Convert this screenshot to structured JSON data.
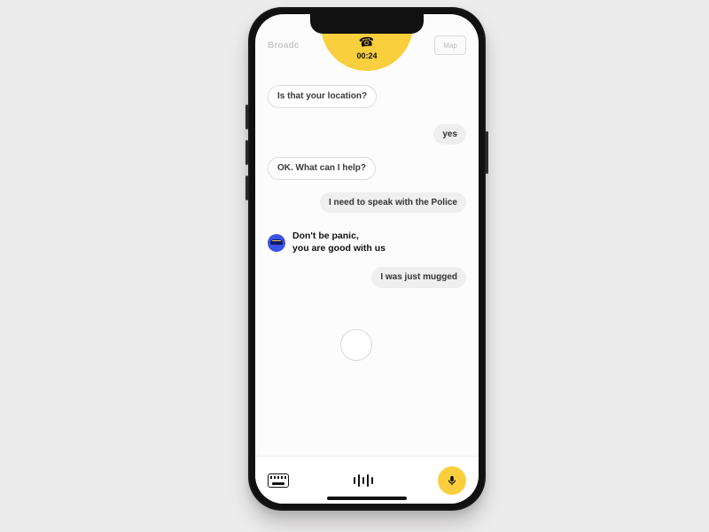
{
  "call": {
    "timer": "00:24",
    "hangup_icon": "hangup-icon"
  },
  "header": {
    "left_label": "Broadc",
    "map_label": "Map"
  },
  "messages": [
    {
      "side": "left",
      "style": "outline",
      "text": "Is that your location?"
    },
    {
      "side": "right",
      "style": "gray",
      "text": "yes"
    },
    {
      "side": "left",
      "style": "outline",
      "text": "OK. What can I help?"
    },
    {
      "side": "right",
      "style": "gray",
      "text": "I need to speak with the Police"
    }
  ],
  "system_message": {
    "avatar": "police-cap-icon",
    "text": "Don't be panic,\nyou are good with us"
  },
  "messages_after": [
    {
      "side": "right",
      "style": "gray",
      "text": "I was just mugged"
    }
  ],
  "bottom": {
    "keyboard_icon": "keyboard-icon",
    "waveform_icon": "waveform-icon",
    "mic_icon": "mic-icon"
  },
  "colors": {
    "accent_yellow": "#f9cf3d",
    "avatar_blue": "#3a53e6"
  }
}
